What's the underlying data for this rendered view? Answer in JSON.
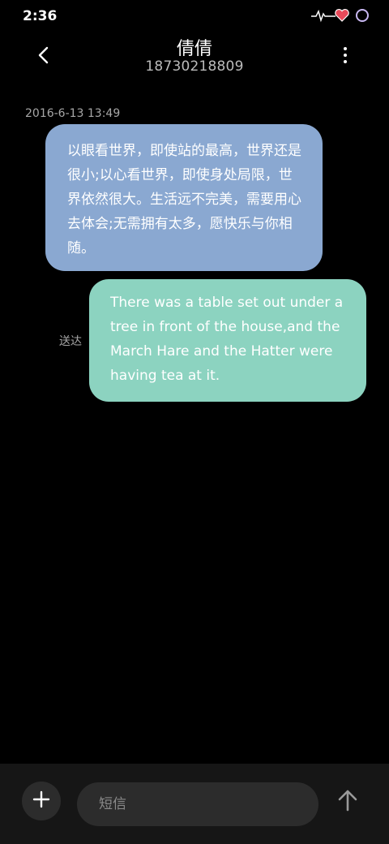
{
  "status_bar": {
    "time": "2:36",
    "icons": [
      "heartbeat-icon",
      "heart-icon",
      "ring-icon"
    ]
  },
  "header": {
    "contact_name": "倩倩",
    "contact_number": "18730218809",
    "back_icon": "chevron-left-icon",
    "more_icon": "vertical-dots-icon"
  },
  "conversation": {
    "timestamp": "2016-6-13 13:49",
    "messages": [
      {
        "direction": "incoming",
        "text": "以眼看世界，即使站的最高，世界还是很小;以心看世界，即使身处局限，世界依然很大。生活远不完美，需要用心去体会;无需拥有太多，愿快乐与你相随。",
        "color": "#8aa8d1"
      },
      {
        "direction": "outgoing",
        "text": "There was a table set out under a tree in front of the house,and the March Hare and the Hatter were having tea at it.",
        "color": "#8cd3c0",
        "status": "送达"
      }
    ]
  },
  "composer": {
    "placeholder": "短信",
    "value": "",
    "add_icon": "plus-icon",
    "send_icon": "arrow-up-icon"
  },
  "colors": {
    "background": "#000000",
    "composer_bar": "#161616",
    "input_field": "#2c2c2c"
  }
}
